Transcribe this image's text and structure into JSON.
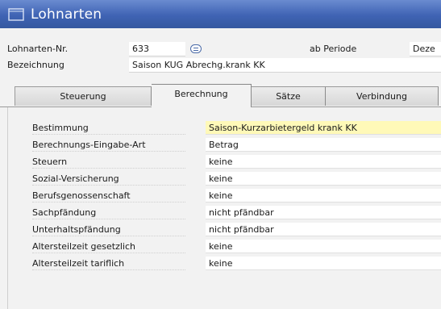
{
  "window": {
    "title": "Lohnarten",
    "icon": "window-icon"
  },
  "header": {
    "lohnarten_nr_label": "Lohnarten-Nr.",
    "lohnarten_nr_value": "633",
    "ab_periode_label": "ab Periode",
    "ab_periode_value": "Deze",
    "bezeichnung_label": "Bezeichnung",
    "bezeichnung_value": "Saison KUG Abrechg.krank KK"
  },
  "tabs": [
    {
      "label": "Steuerung",
      "active": false
    },
    {
      "label": "Berechnung",
      "active": true
    },
    {
      "label": "Sätze",
      "active": false
    },
    {
      "label": "Verbindung",
      "active": false
    }
  ],
  "fields": [
    {
      "label": "Bestimmung",
      "value": "Saison-Kurzarbietergeld krank KK",
      "highlight": true
    },
    {
      "label": "Berechnungs-Eingabe-Art",
      "value": "Betrag"
    },
    {
      "label": "Steuern",
      "value": "keine"
    },
    {
      "label": "Sozial-Versicherung",
      "value": "keine"
    },
    {
      "label": "Berufsgenossenschaft",
      "value": "keine"
    },
    {
      "label": "Sachpfändung",
      "value": "nicht pfändbar"
    },
    {
      "label": "Unterhaltspfändung",
      "value": "nicht pfändbar"
    },
    {
      "label": "Altersteilzeit gesetzlich",
      "value": "keine"
    },
    {
      "label": "Altersteilzeit tariflich",
      "value": "keine"
    }
  ],
  "colors": {
    "titlebar": "#3f63b4",
    "highlight_field": "#fff9b8",
    "field_bg": "#ffffff",
    "panel_bg": "#f2f2f2"
  }
}
